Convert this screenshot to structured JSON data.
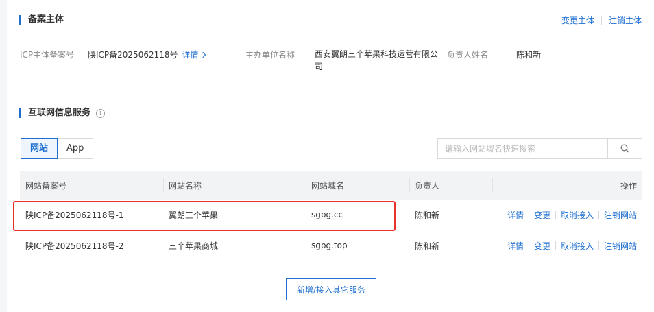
{
  "subject": {
    "title": "备案主体",
    "actions": [
      "变更主体",
      "注销主体"
    ],
    "icp_label": "ICP主体备案号",
    "icp_value": "陕ICP备2025062118号",
    "detail_link": "详情",
    "org_label": "主办单位名称",
    "org_value_line1": "西安翼朗三个苹果科技运营有限公",
    "org_value_line2": "司",
    "owner_label": "负责人姓名",
    "owner_value": "陈和新"
  },
  "service": {
    "title": "互联网信息服务",
    "info_icon": "i"
  },
  "tabs": [
    "网站",
    "App"
  ],
  "search": {
    "placeholder": "请输入网站域名快速搜索",
    "icon": "search-icon"
  },
  "table": {
    "headers": [
      "网站备案号",
      "网站名称",
      "网站域名",
      "负责人",
      "操作"
    ],
    "rows": [
      {
        "icp": "陕ICP备2025062118号-1",
        "name": "翼朗三个苹果",
        "domain": "sgpg.cc",
        "owner": "陈和新",
        "ops": [
          "详情",
          "变更",
          "取消接入",
          "注销网站"
        ]
      },
      {
        "icp": "陕ICP备2025062118号-2",
        "name": "三个苹果商城",
        "domain": "sgpg.top",
        "owner": "陈和新",
        "ops": [
          "详情",
          "变更",
          "取消接入",
          "注销网站"
        ]
      }
    ]
  },
  "add_button": "新增/接入其它服务",
  "colors": {
    "accent": "#1e6fd0",
    "highlight": "#e8332c"
  }
}
